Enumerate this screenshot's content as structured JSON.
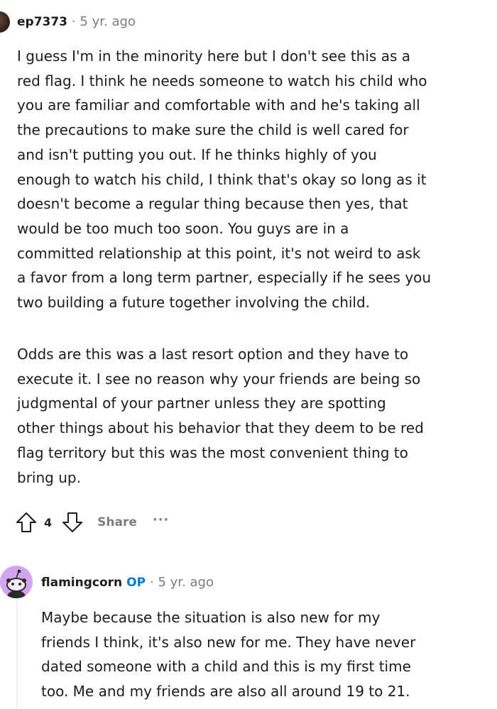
{
  "comments": [
    {
      "username": "ep7373",
      "separator": "·",
      "time": "5 yr. ago",
      "paragraphs": [
        [
          "I guess I'm in the minority here but I don't see this as a",
          "red flag. I think he needs someone to watch his child who",
          "you are familiar and comfortable with and he's taking all",
          "the precautions to make sure the child is well cared for",
          "and isn't putting you out. If he thinks highly of you",
          "enough to watch his child, I think that's okay so long as it",
          "doesn't become a regular thing because then yes, that",
          "would be too much too soon. You guys are in a",
          "committed relationship at this point, it's not weird to ask",
          "a favor from a long term partner, especially if he sees you",
          "two building a future together involving the child."
        ],
        [
          "Odds are this was a last resort option and they have to",
          "execute it. I see no reason why your friends are being so",
          "judgmental of your partner unless they are spotting",
          "other things about his behavior that they deem to be red",
          "flag territory but this was the most convenient thing to",
          "bring up."
        ]
      ],
      "actions": {
        "vote_count": "4",
        "share_label": "Share",
        "more_label": "···",
        "upvote_icon": "upvote-arrow-icon",
        "downvote_icon": "downvote-arrow-icon"
      }
    },
    {
      "username": "flamingcorn",
      "badge": "OP",
      "separator": "·",
      "time": "5 yr. ago",
      "avatar_color": "#d4a5ef",
      "paragraphs": [
        [
          "Maybe because the situation is also new for my",
          "friends I think, it's also new for me. They have never",
          "dated someone with a child and this is my first time",
          "too. Me and my friends are also all around 19 to 21."
        ]
      ]
    }
  ],
  "colors": {
    "text": "#1c1c1c",
    "meta": "#7c7c7c",
    "op_badge": "#0079d3",
    "thread_line": "#edeff1"
  }
}
